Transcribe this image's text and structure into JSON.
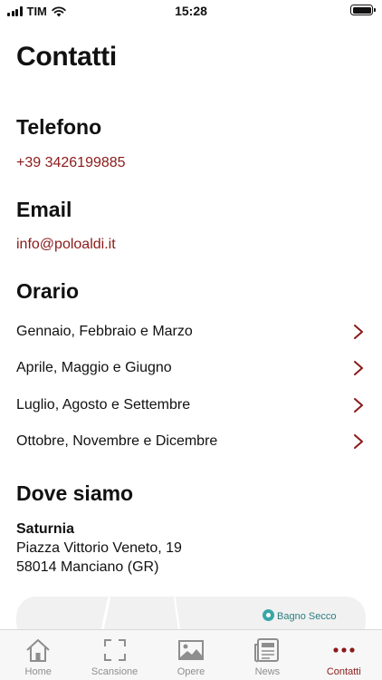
{
  "status_bar": {
    "carrier": "TIM",
    "time": "15:28"
  },
  "page_title": "Contatti",
  "phone": {
    "title": "Telefono",
    "value": "+39 3426199885"
  },
  "email": {
    "title": "Email",
    "value": "info@poloaldi.it"
  },
  "hours": {
    "title": "Orario",
    "items": [
      {
        "label": "Gennaio, Febbraio e Marzo"
      },
      {
        "label": "Aprile, Maggio e Giugno"
      },
      {
        "label": "Luglio, Agosto e Settembre"
      },
      {
        "label": "Ottobre, Novembre e Dicembre"
      }
    ]
  },
  "location": {
    "title": "Dove siamo",
    "city": "Saturnia",
    "street": "Piazza Vittorio Veneto, 19",
    "postal": "58014 Manciano (GR)",
    "map_label": "Bagno Secco"
  },
  "tabs": [
    {
      "label": "Home",
      "icon": "home-icon"
    },
    {
      "label": "Scansione",
      "icon": "scan-icon"
    },
    {
      "label": "Opere",
      "icon": "image-icon"
    },
    {
      "label": "News",
      "icon": "newspaper-icon"
    },
    {
      "label": "Contatti",
      "icon": "more-icon",
      "active": true
    }
  ],
  "colors": {
    "accent": "#8b1a1a",
    "inactive": "#8e8e8e",
    "map_poi": "#3aa6a8"
  }
}
